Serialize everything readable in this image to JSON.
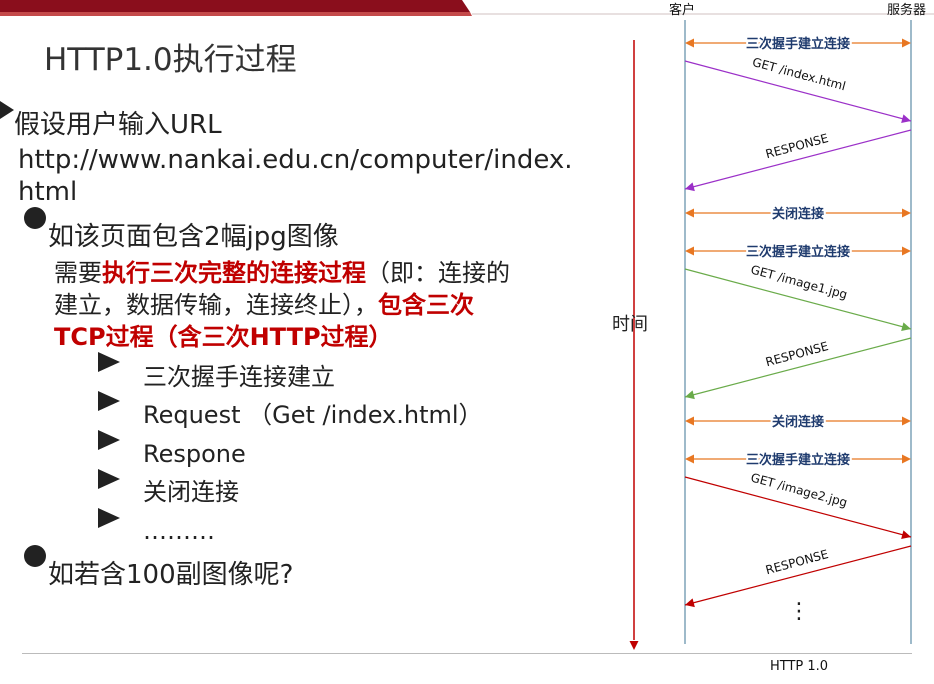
{
  "title": "HTTP1.0执行过程",
  "intro": "假设用户输入URL",
  "url": {
    "line1": "http://www.nankai.edu.cn/computer/index.",
    "line2": "html"
  },
  "bullet1": "如该页面包含2幅jpg图像",
  "paragraph": {
    "part1": "需要",
    "part2_bold": "执行三次完整的连接过程",
    "part3": "（即：连接的",
    "line2_normal": "建立，数据传输，连接终止），",
    "line2_bold": "包含三次",
    "line3_bold": "TCP过程（含三次HTTP过程）"
  },
  "sub_items": [
    "三次握手连接建立",
    "Request （Get /index.html）",
    "Respone",
    "关闭连接",
    "………"
  ],
  "bullet2": "如若含100副图像呢?",
  "diagram": {
    "client_label": "客户",
    "server_label": "服务器",
    "time_label": "时间",
    "caption": "HTTP 1.0",
    "vertical_ellipsis": "⋮",
    "colors": {
      "handshake": "#e87722",
      "exchange1": "#9b30c8",
      "exchange2": "#6aab4a",
      "exchange3": "#c00000",
      "time_axis": "#c00000",
      "lifelines": "#7fa3b8",
      "arrow_label": "#1f3b6e"
    },
    "rounds": [
      {
        "handshake": "三次握手建立连接",
        "request": "GET /index.html",
        "response": "RESPONSE",
        "close": "关闭连接",
        "color_key": "exchange1"
      },
      {
        "handshake": "三次握手建立连接",
        "request": "GET /image1.jpg",
        "response": "RESPONSE",
        "close": "关闭连接",
        "color_key": "exchange2"
      },
      {
        "handshake": "三次握手建立连接",
        "request": "GET /image2.jpg",
        "response": "RESPONSE",
        "close": "",
        "color_key": "exchange3"
      }
    ]
  }
}
